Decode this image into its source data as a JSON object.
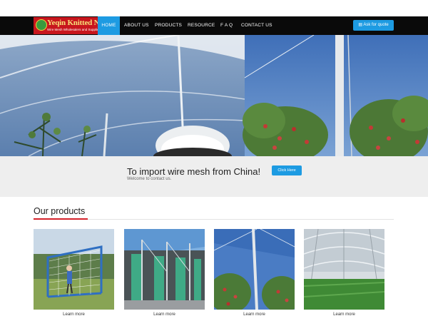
{
  "logo": {
    "title": "Yeqin Knitted Net",
    "subtitle": "Wire Mesh Wholesalers and Suppliers"
  },
  "nav": {
    "items": [
      "HOME",
      "ABOUT US",
      "PRODUCTS",
      "RESOURCE",
      "F A Q",
      "CONTACT US"
    ],
    "active": "HOME",
    "quote_label": "Ask for quote",
    "quote_icon": "document-icon"
  },
  "cta": {
    "title": "To import wire mesh from China!",
    "subtitle": "Welcome to contact us.",
    "button_label": "Click Here"
  },
  "products": {
    "title": "Our products",
    "items": [
      {
        "learn_label": "Learn more"
      },
      {
        "learn_label": "Learn more"
      },
      {
        "learn_label": "Learn more"
      },
      {
        "learn_label": "Learn more"
      }
    ]
  },
  "colors": {
    "accent": "#1d9be2",
    "navbar": "#0a0a0a",
    "logo_bg": "#c8161d",
    "section_accent": "#d4212a",
    "cta_bg": "#eeeeee"
  }
}
